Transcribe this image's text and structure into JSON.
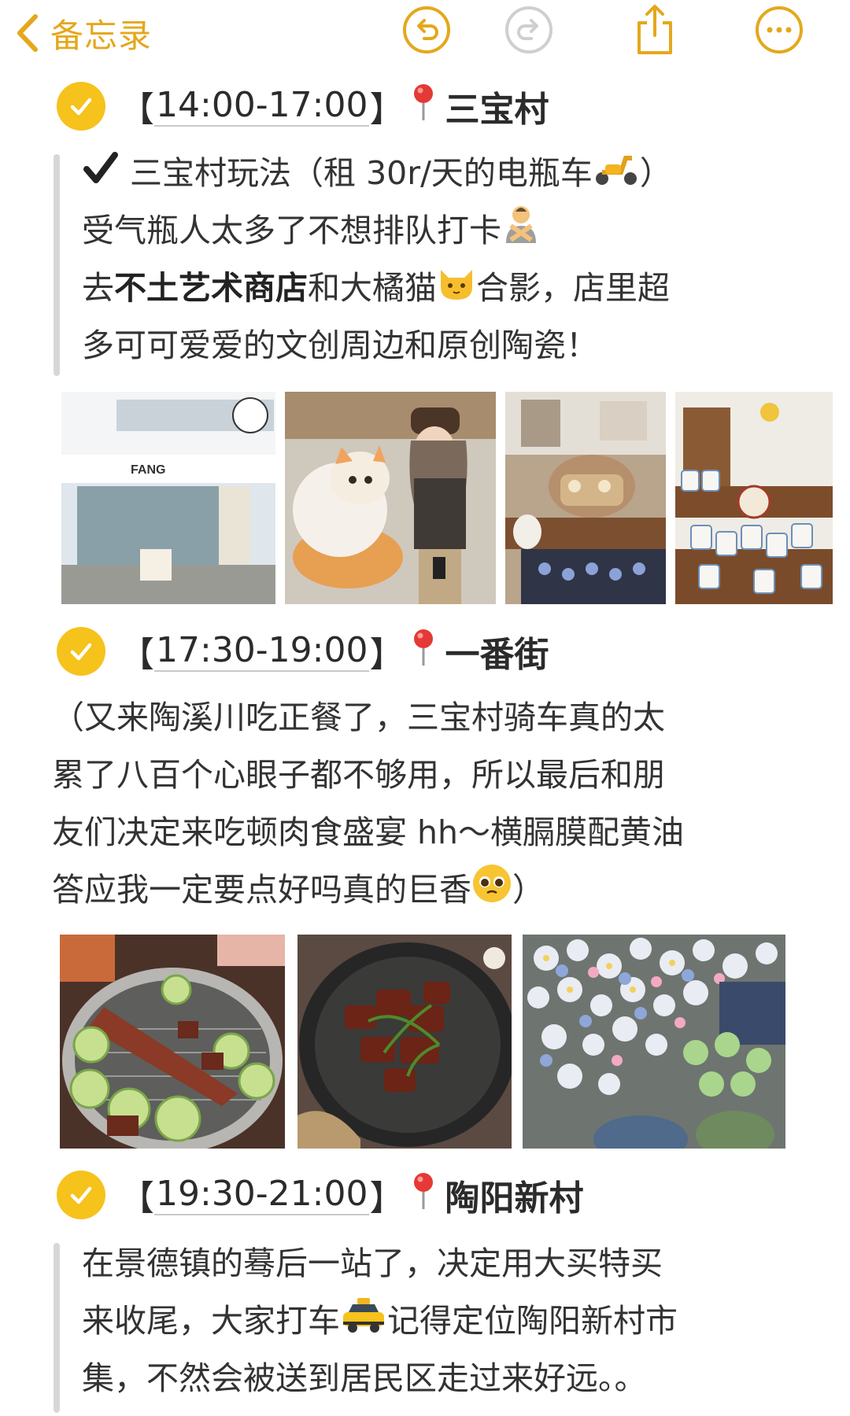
{
  "nav": {
    "back_label": "备忘录",
    "icons": [
      "chevron-left-icon",
      "undo-icon",
      "redo-icon",
      "share-icon",
      "more-icon"
    ],
    "accent": "#E4A81C"
  },
  "sections": [
    {
      "time": "14:00-17:00",
      "place": "三宝村",
      "lines": [
        {
          "pre": "三宝村玩法（租 30r/天的电瓶车",
          "post": "）"
        },
        {
          "pre": "受气瓶人太多了不想排队打卡",
          "post": ""
        },
        {
          "pre": "去",
          "bold": "不土艺术商店",
          "mid": "和大橘猫",
          "post": "合影，店里超"
        },
        {
          "pre": "多可可爱爱的文创周边和原创陶瓷！",
          "post": ""
        }
      ],
      "photos": [
        "store-front",
        "cat-statue-with-girl",
        "ceramic-catbus-display",
        "ceramic-cups-shelf"
      ]
    },
    {
      "time": "17:30-19:00",
      "place": "一番街",
      "lines": [
        {
          "pre": "（又来陶溪川吃正餐了，三宝村骑车真的太"
        },
        {
          "pre": "累了八百个心眼子都不够用，所以最后和朋"
        },
        {
          "pre": "友们决定来吃顿肉食盛宴 hh～横膈膜配黄油"
        },
        {
          "pre": "答应我一定要点好吗真的巨香",
          "post": "）"
        }
      ],
      "photos": [
        "bbq-grill",
        "steak-plate",
        "ceramic-flowers"
      ]
    },
    {
      "time": "19:30-21:00",
      "place": "陶阳新村",
      "lines": [
        {
          "pre": "在景德镇的蓦后一站了，决定用大买特买"
        },
        {
          "pre": "来收尾，大家打车",
          "post": "记得定位陶阳新村市"
        },
        {
          "pre": "集，不然会被送到居民区走过来好远。。"
        }
      ]
    }
  ],
  "colors": {
    "check": "#F6C21C",
    "pin": "#E53935",
    "bar": "#d7d7d7"
  }
}
